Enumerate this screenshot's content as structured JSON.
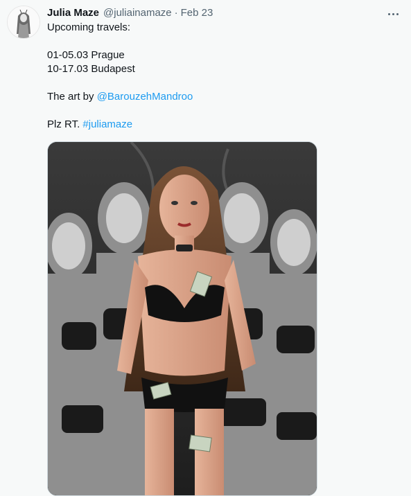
{
  "tweet": {
    "author_name": "Julia Maze",
    "handle": "@juliainamaze",
    "separator": "·",
    "date": "Feb 23",
    "lines": {
      "l1": "Upcoming travels:",
      "l2": "01-05.03 Prague",
      "l3": "10-17.03 Budapest",
      "l4_prefix": "The art by ",
      "l4_mention": "@BarouzehMandroo",
      "l5_prefix": "Plz RT. ",
      "l5_hashtag": "#juliamaze"
    }
  },
  "icons": {
    "more": "more-horizontal-icon",
    "avatar": "avatar-illustration"
  },
  "colors": {
    "link": "#1d9bf0",
    "secondary_text": "#536471",
    "primary_text": "#0f1419",
    "background": "#f7f9f9"
  }
}
